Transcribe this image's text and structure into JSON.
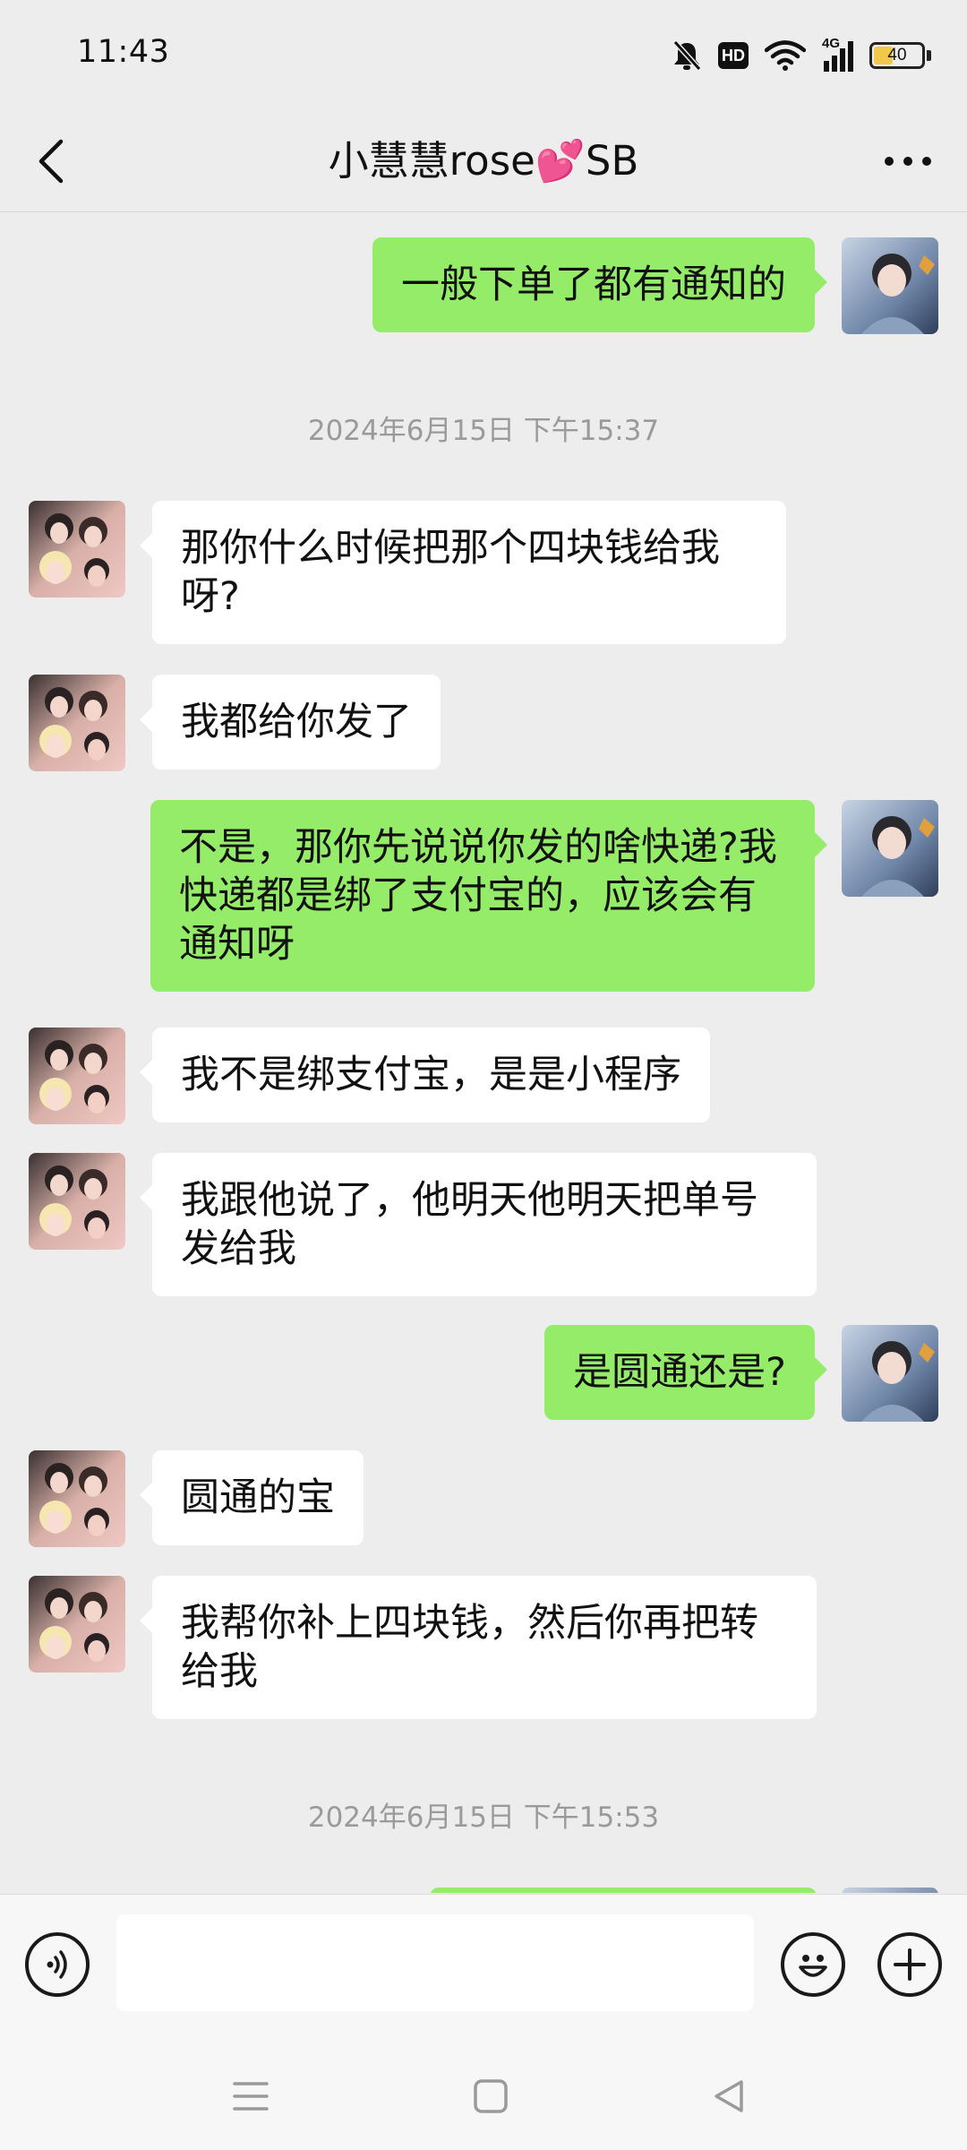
{
  "status_bar": {
    "time": "11:43",
    "network": "4G",
    "hd_label": "HD",
    "battery_level": "40",
    "battery_fraction": 0.4,
    "icons": [
      "mute-bell-icon",
      "hd-icon",
      "wifi-icon",
      "signal-icon",
      "battery-icon"
    ]
  },
  "header": {
    "title": "小慧慧rose💕SB",
    "back_icon": "chevron-left-icon",
    "more_icon": "ellipsis-icon"
  },
  "messages": [
    {
      "side": "out",
      "text": "一般下单了都有通知的"
    },
    {
      "type": "timestamp",
      "text": "2024年6月15日 下午15:37"
    },
    {
      "side": "in",
      "text": "那你什么时候把那个四块钱给我呀?"
    },
    {
      "side": "in",
      "text": "我都给你发了"
    },
    {
      "side": "out",
      "text": "不是，那你先说说你发的啥快递?我快递都是绑了支付宝的，应该会有通知呀"
    },
    {
      "side": "in",
      "text": "我不是绑支付宝，是是小程序"
    },
    {
      "side": "in",
      "text": "我跟他说了，他明天他明天把单号发给我"
    },
    {
      "side": "out",
      "text": "是圆通还是?"
    },
    {
      "side": "in",
      "text": "圆通的宝"
    },
    {
      "side": "in",
      "text": "我帮你补上四块钱，然后你再把转给我"
    },
    {
      "type": "timestamp",
      "text": "2024年6月15日 下午15:53"
    }
  ],
  "input_bar": {
    "voice_icon": "voice-icon",
    "emoji_icon": "emoji-icon",
    "plus_icon": "plus-icon",
    "input_value": ""
  },
  "nav_bar": {
    "icons": [
      "menu-icon",
      "home-icon",
      "back-triangle-icon"
    ]
  },
  "colors": {
    "background": "#ededed",
    "outgoing_bubble": "#95ec69",
    "incoming_bubble": "#ffffff",
    "timestamp_text": "#9a9a9a",
    "battery_fill": "#f3c74a"
  }
}
